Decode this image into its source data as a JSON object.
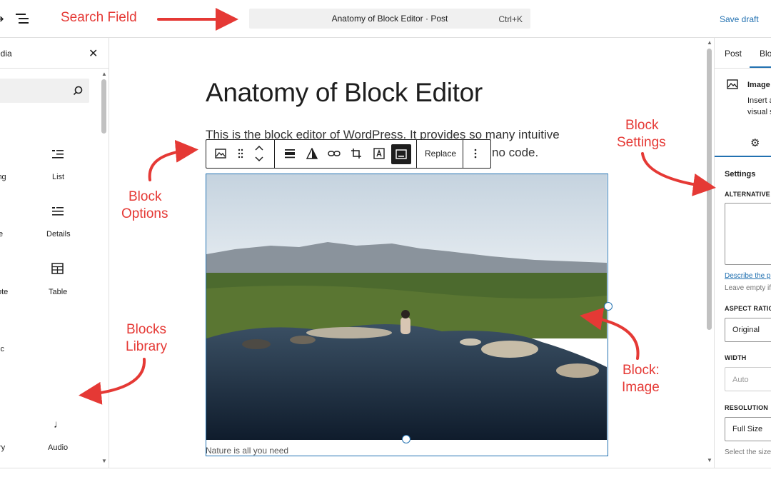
{
  "topbar": {
    "search_title": "Anatomy of Block Editor · Post",
    "search_shortcut": "Ctrl+K",
    "save_draft_label": "Save draft"
  },
  "left_panel": {
    "tab_label": "edia",
    "blocks": [
      {
        "label": "ing",
        "icon": "heading-icon"
      },
      {
        "label": "List",
        "icon": "list-icon"
      },
      {
        "label": "e",
        "icon": "image-icon"
      },
      {
        "label": "Details",
        "icon": "details-icon"
      },
      {
        "label": "ote",
        "icon": "quote-icon"
      },
      {
        "label": "Table",
        "icon": "table-icon"
      },
      {
        "label": "ic",
        "icon": "classic-icon"
      },
      {
        "label": "ry",
        "icon": "gallery-icon"
      },
      {
        "label": "Audio",
        "icon": "audio-icon"
      }
    ]
  },
  "canvas": {
    "post_title": "Anatomy of Block Editor",
    "paragraph_line1": "This is the block editor of WordPress. It provides so many intuitive",
    "paragraph_line2": "no code.",
    "toolbar_replace_label": "Replace",
    "caption": "Nature is all you need"
  },
  "right_panel": {
    "tab_post": "Post",
    "tab_block": "Blo",
    "block_name": "Image",
    "block_desc_line1": "Insert a",
    "block_desc_line2": "visual s",
    "settings_heading": "Settings",
    "alt_text_label": "ALTERNATIVE T",
    "describe_link": "Describe the p",
    "leave_empty": "Leave empty if",
    "aspect_ratio_label": "ASPECT RATIO",
    "aspect_ratio_value": "Original",
    "width_label": "WIDTH",
    "width_placeholder": "Auto",
    "resolution_label": "RESOLUTION",
    "resolution_value": "Full Size",
    "resolution_help": "Select the size"
  },
  "annotations": {
    "search_field": "Search Field",
    "block_options_1": "Block",
    "block_options_2": "Options",
    "block_settings_1": "Block",
    "block_settings_2": "Settings",
    "blocks_library_1": "Blocks",
    "blocks_library_2": "Library",
    "block_image_1": "Block:",
    "block_image_2": "Image"
  },
  "colors": {
    "accent": "#2271b1",
    "annotation": "#e53935",
    "toolbar_active": "#1e1e1e"
  }
}
